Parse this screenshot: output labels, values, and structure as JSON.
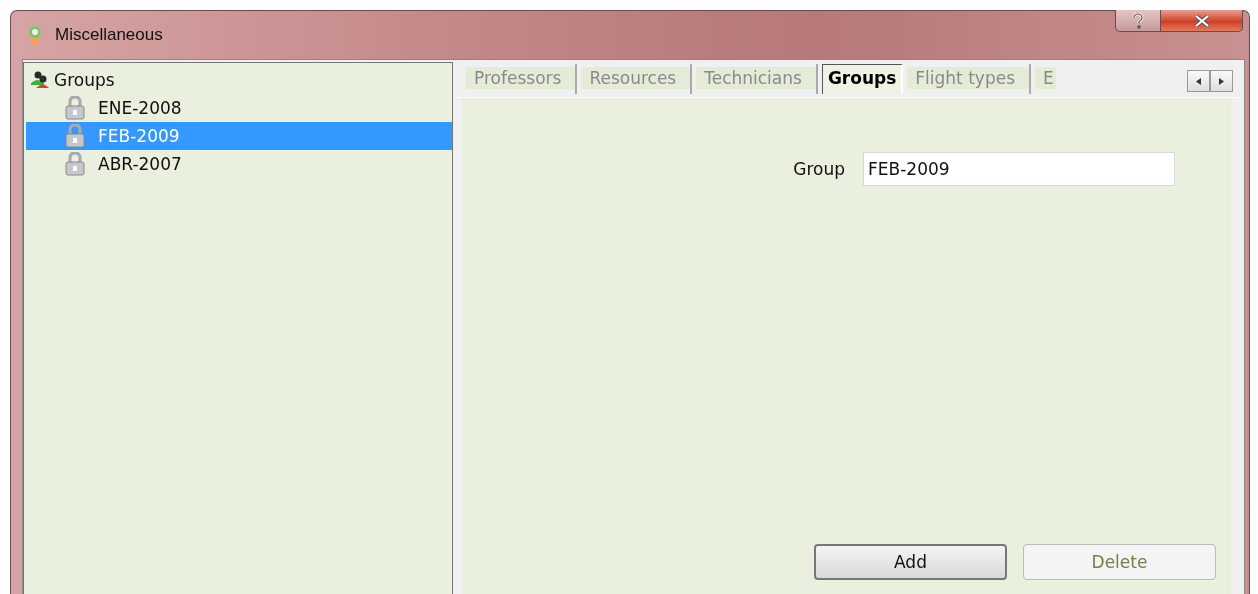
{
  "window": {
    "title": "Miscellaneous"
  },
  "tree": {
    "label": "Groups",
    "children": [
      {
        "label": "ENE-2008",
        "selected": false
      },
      {
        "label": "FEB-2009",
        "selected": true
      },
      {
        "label": "ABR-2007",
        "selected": false
      }
    ]
  },
  "tabs": [
    {
      "label": "Professors",
      "selected": false
    },
    {
      "label": "Resources",
      "selected": false
    },
    {
      "label": "Technicians",
      "selected": false
    },
    {
      "label": "Groups",
      "selected": true
    },
    {
      "label": "Flight types",
      "selected": false
    },
    {
      "label": "E",
      "selected": false
    }
  ],
  "form": {
    "label": "Group",
    "value": "FEB-2009"
  },
  "buttons": [
    {
      "label": "Add",
      "disabled": false
    },
    {
      "label": "Delete",
      "disabled": true
    }
  ]
}
